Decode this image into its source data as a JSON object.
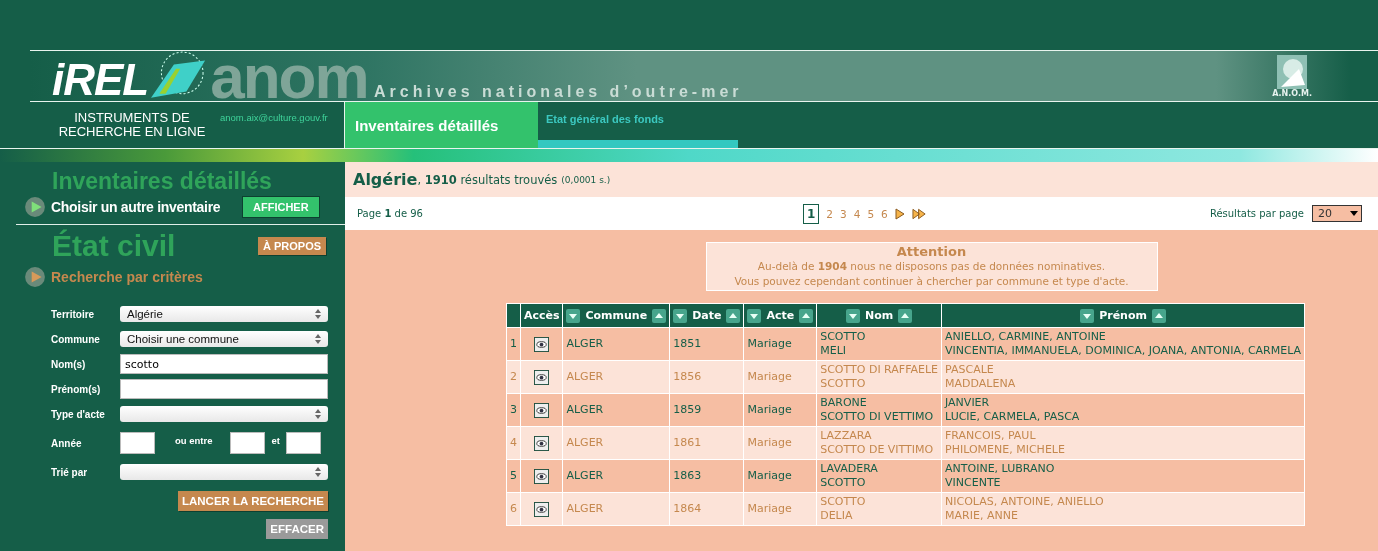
{
  "header": {
    "logo_text": "iREL",
    "brand_text": "anom",
    "subtitle": "Archives nationales d’outre-mer",
    "tagline": "INSTRUMENTS DE RECHERCHE EN LIGNE",
    "email": "anom.aix@culture.gouv.fr",
    "emblem_caption": "A.N.O.M."
  },
  "tabs": [
    {
      "label": "Inventaires détaillés",
      "selected": true
    },
    {
      "label": "Etat général des fonds",
      "selected": false
    }
  ],
  "sidebar": {
    "inventory_title": "Inventaires détaillés",
    "inventory_link": "Choisir un autre inventaire",
    "show_button": "AFFICHER",
    "civil_title": "État civil",
    "about_button": "À PROPOS",
    "criteria_title": "Recherche par critères",
    "fields": [
      {
        "kind": "select",
        "label": "Territoire",
        "value": "Algérie"
      },
      {
        "kind": "select",
        "label": "Commune",
        "value": "Choisir une commune"
      },
      {
        "kind": "text",
        "label": "Nom(s)",
        "value": "scotto"
      },
      {
        "kind": "text",
        "label": "Prénom(s)"
      },
      {
        "kind": "select",
        "label": "Type d'acte"
      },
      {
        "kind": "range",
        "label": "Année",
        "between": "ou entre",
        "and": "et"
      },
      {
        "kind": "select",
        "label": "Trié par"
      }
    ],
    "search_button": "LANCER LA RECHERCHE",
    "clear_button": "EFFACER"
  },
  "results": {
    "title": "Algérie",
    "summary": ", **1910** résultats trouvés",
    "timing": "(0,0001 s.)"
  },
  "pager": {
    "page_info": "Page **1** de 96",
    "pages": [
      {
        "label": "1",
        "selected": true
      },
      {
        "label": "2",
        "selected": false
      },
      {
        "label": "3",
        "selected": false
      },
      {
        "label": "4",
        "selected": false
      },
      {
        "label": "5",
        "selected": false
      },
      {
        "label": "6",
        "selected": false
      }
    ],
    "per_page_label": "Résultats par page",
    "per_page": "20"
  },
  "notice": {
    "title": "Attention",
    "lines": [
      "Au-delà de **1904** nous ne disposons pas de données nominatives.",
      "Vous pouvez cependant continuer à chercher par commune et type d'acte."
    ]
  },
  "table": {
    "columns": [
      {
        "label": "Accès",
        "sortable": false
      },
      {
        "label": "Commune",
        "sortable": true
      },
      {
        "label": "Date",
        "sortable": true
      },
      {
        "label": "Acte",
        "sortable": true
      },
      {
        "label": "Nom",
        "sortable": true
      },
      {
        "label": "Prénom",
        "sortable": true
      }
    ],
    "rows": [
      {
        "number": "1",
        "commune": "ALGER",
        "date": "1851",
        "acte": "Mariage",
        "nom": [
          "SCOTTO",
          "MELI"
        ],
        "prenom": [
          "ANIELLO, CARMINE, ANTOINE",
          "VINCENTIA, IMMANUELA, DOMINICA, JOANA, ANTONIA, CARMELA"
        ]
      },
      {
        "number": "2",
        "commune": "ALGER",
        "date": "1856",
        "acte": "Mariage",
        "nom": [
          "SCOTTO DI RAFFAELE",
          "SCOTTO"
        ],
        "prenom": [
          "PASCALE",
          "MADDALENA"
        ]
      },
      {
        "number": "3",
        "commune": "ALGER",
        "date": "1859",
        "acte": "Mariage",
        "nom": [
          "BARONE",
          "SCOTTO DI VETTIMO"
        ],
        "prenom": [
          "JANVIER",
          "LUCIE, CARMELA, PASCA"
        ]
      },
      {
        "number": "4",
        "commune": "ALGER",
        "date": "1861",
        "acte": "Mariage",
        "nom": [
          "LAZZARA",
          "SCOTTO DE VITTIMO"
        ],
        "prenom": [
          "FRANCOIS, PAUL",
          "PHILOMENE, MICHELE"
        ]
      },
      {
        "number": "5",
        "commune": "ALGER",
        "date": "1863",
        "acte": "Mariage",
        "nom": [
          "LAVADERA",
          "SCOTTO"
        ],
        "prenom": [
          "ANTOINE, LUBRANO",
          "VINCENTE"
        ]
      },
      {
        "number": "6",
        "commune": "ALGER",
        "date": "1864",
        "acte": "Mariage",
        "nom": [
          "SCOTTO",
          "DELIA"
        ],
        "prenom": [
          "NICOLAS, ANTOINE, ANIELLO",
          "MARIE, ANNE"
        ]
      }
    ]
  }
}
